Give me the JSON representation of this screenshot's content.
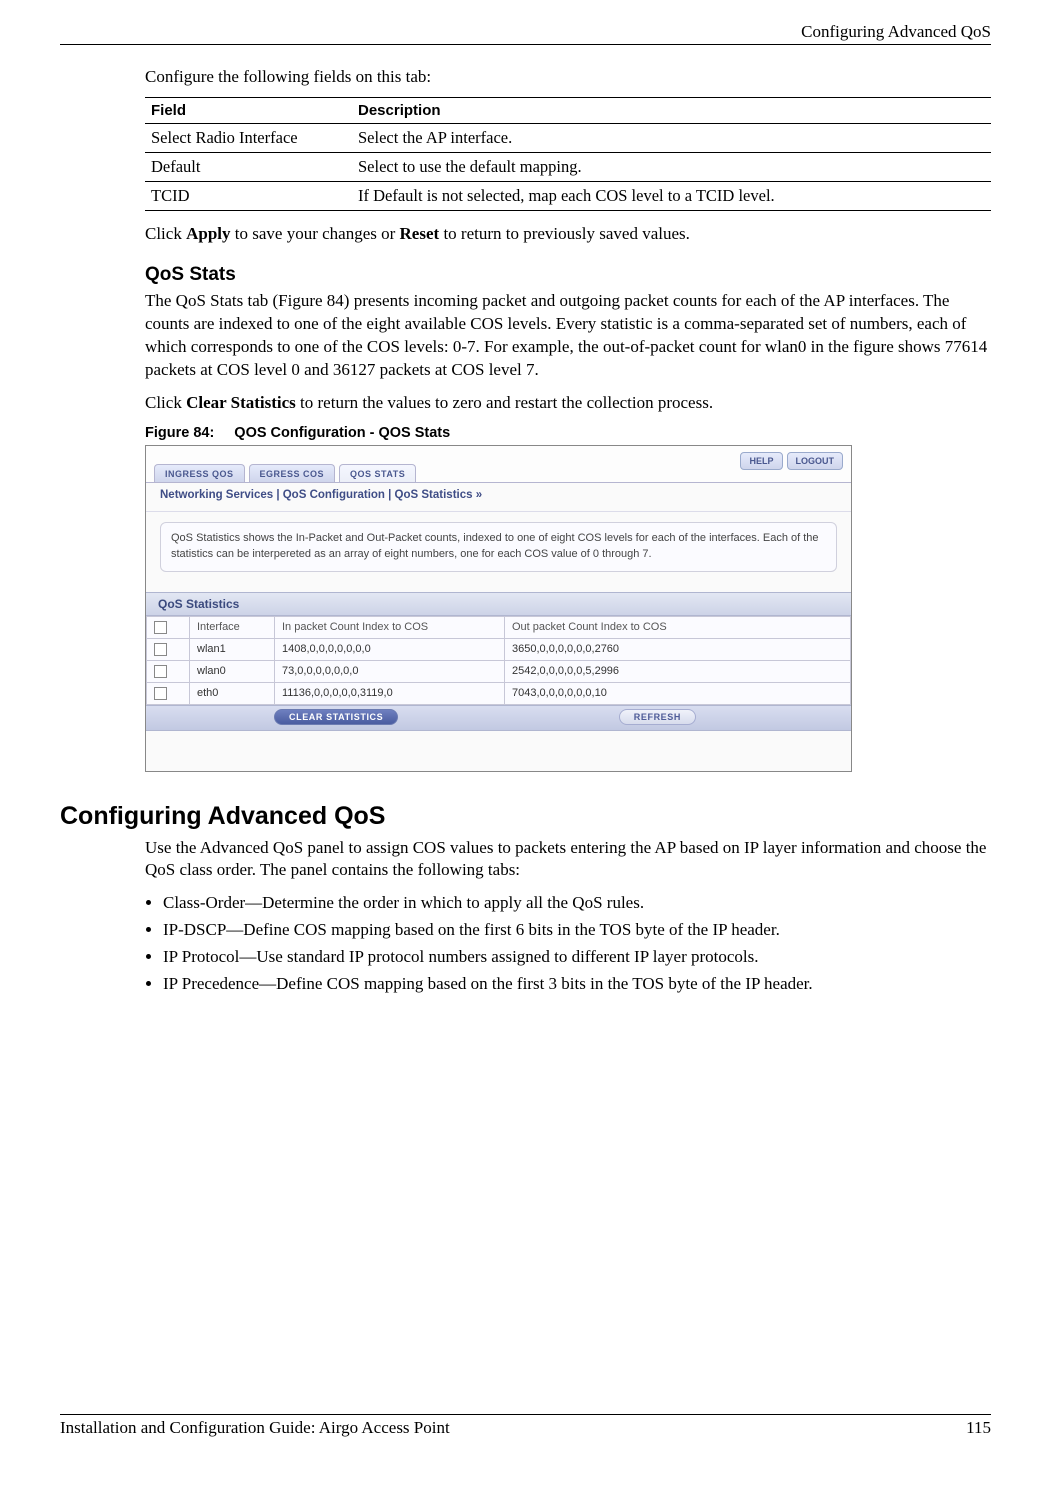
{
  "header": {
    "section_title": "Configuring Advanced QoS"
  },
  "intro": "Configure the following fields on this tab:",
  "field_table": {
    "col_field": "Field",
    "col_desc": "Description",
    "rows": [
      {
        "field": "Select Radio Interface",
        "desc": "Select the AP interface."
      },
      {
        "field": "Default",
        "desc": "Select to use the default mapping."
      },
      {
        "field": "TCID",
        "desc": "If Default is not selected, map each COS level to a TCID level."
      }
    ]
  },
  "apply_line": {
    "pre": "Click ",
    "b1": "Apply",
    "mid": " to save your changes or ",
    "b2": "Reset",
    "post": " to return to previously saved values."
  },
  "qos_stats_heading": "QoS Stats",
  "qos_stats_para": "The QoS Stats tab (Figure 84) presents incoming packet and outgoing packet counts for each of the AP interfaces. The counts are indexed to one of the eight available COS levels. Every statistic is a comma-separated set of numbers, each of which corresponds to one of the COS levels: 0-7. For example, the out-of-packet count for wlan0 in the figure shows 77614 packets at COS level 0 and 36127 packets at COS level 7.",
  "clear_stats_line": {
    "pre": "Click ",
    "b1": "Clear Statistics",
    "post": " to return the values to zero and restart the collection process."
  },
  "figure_caption_prefix": "Figure 84:",
  "figure_caption_title": "QOS Configuration - QOS Stats",
  "screenshot": {
    "tabs": {
      "ingress": "INGRESS QOS",
      "egress": "EGRESS COS",
      "stats": "QOS STATS"
    },
    "top_buttons": {
      "help": "HELP",
      "logout": "LOGOUT"
    },
    "breadcrumb": "Networking Services | QoS Configuration | QoS Statistics  »",
    "desc": "QoS Statistics shows the In-Packet and Out-Packet counts, indexed to one of eight COS levels for each of the interfaces. Each of the statistics can be interpereted as an array of eight numbers, one for each COS value of 0 through 7.",
    "panel_title": "QoS Statistics",
    "cols": {
      "iface": "Interface",
      "inpkt": "In packet Count Index to COS",
      "outpkt": "Out packet Count Index to COS"
    },
    "rows": [
      {
        "iface": "wlan1",
        "inpkt": "1408,0,0,0,0,0,0,0",
        "outpkt": "3650,0,0,0,0,0,0,2760"
      },
      {
        "iface": "wlan0",
        "inpkt": "73,0,0,0,0,0,0,0",
        "outpkt": "2542,0,0,0,0,0,5,2996"
      },
      {
        "iface": "eth0",
        "inpkt": "11136,0,0,0,0,0,3119,0",
        "outpkt": "7043,0,0,0,0,0,0,10"
      }
    ],
    "buttons": {
      "clear": "CLEAR STATISTICS",
      "refresh": "REFRESH"
    }
  },
  "adv_heading": "Configuring Advanced QoS",
  "adv_para": "Use the Advanced QoS panel to assign COS values to packets entering the AP based on IP layer information and choose the QoS class order. The panel contains the following tabs:",
  "adv_bullets": [
    "Class-Order—Determine the order in which to apply all the QoS rules.",
    "IP-DSCP—Define COS mapping based on the first 6 bits in the TOS byte of the IP header.",
    "IP Protocol—Use standard IP protocol numbers assigned to different IP layer protocols.",
    "IP Precedence—Define COS mapping based on the first 3 bits in the TOS byte of the IP header."
  ],
  "footer": {
    "left": "Installation and Configuration Guide: Airgo Access Point",
    "right": "115"
  }
}
